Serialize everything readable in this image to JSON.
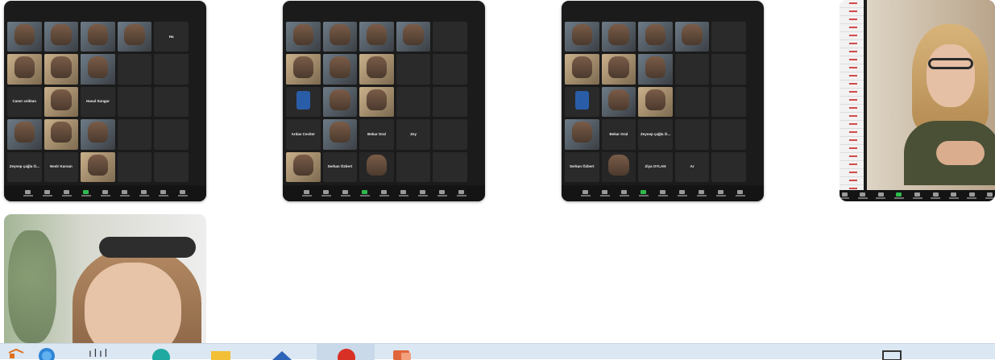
{
  "screen": "Zoom gallery view thumbnails on desktop",
  "thumbnails": [
    {
      "columns": 5,
      "tiles": [
        {
          "kind": "video",
          "bg": "room"
        },
        {
          "kind": "video",
          "bg": "room"
        },
        {
          "kind": "video",
          "bg": "room",
          "name": ""
        },
        {
          "kind": "video",
          "bg": "room",
          "name": ""
        },
        {
          "kind": "text",
          "text": "Ha"
        },
        {
          "kind": "video",
          "bg": "warm"
        },
        {
          "kind": "video",
          "bg": "warm"
        },
        {
          "kind": "video",
          "bg": "room",
          "active": true
        },
        {
          "kind": "text",
          "text": ""
        },
        {
          "kind": "text",
          "text": ""
        },
        {
          "kind": "text",
          "text": "Caner ceiktan"
        },
        {
          "kind": "video",
          "bg": "warm"
        },
        {
          "kind": "text",
          "text": "Hasal Sungar"
        },
        {
          "kind": "text",
          "text": ""
        },
        {
          "kind": "text",
          "text": ""
        },
        {
          "kind": "video",
          "bg": "room"
        },
        {
          "kind": "video",
          "bg": "warm"
        },
        {
          "kind": "video",
          "bg": "room"
        },
        {
          "kind": "text",
          "text": ""
        },
        {
          "kind": "text",
          "text": ""
        },
        {
          "kind": "text",
          "text": "Zeynep çağla Ö..."
        },
        {
          "kind": "text",
          "text": "Neslr Karsan"
        },
        {
          "kind": "video",
          "bg": "warm"
        },
        {
          "kind": "text",
          "text": ""
        },
        {
          "kind": "text",
          "text": ""
        }
      ]
    },
    {
      "columns": 5,
      "tiles": [
        {
          "kind": "video",
          "bg": "room"
        },
        {
          "kind": "video",
          "bg": "room"
        },
        {
          "kind": "video",
          "bg": "room"
        },
        {
          "kind": "video",
          "bg": "room"
        },
        {
          "kind": "text",
          "text": ""
        },
        {
          "kind": "video",
          "bg": "warm",
          "active": true
        },
        {
          "kind": "video",
          "bg": "room"
        },
        {
          "kind": "video",
          "bg": "warm"
        },
        {
          "kind": "text",
          "text": ""
        },
        {
          "kind": "text",
          "text": ""
        },
        {
          "kind": "badge"
        },
        {
          "kind": "video",
          "bg": "room"
        },
        {
          "kind": "video",
          "bg": "warm"
        },
        {
          "kind": "text",
          "text": ""
        },
        {
          "kind": "text",
          "text": ""
        },
        {
          "kind": "text",
          "text": "Ardas Ceviter"
        },
        {
          "kind": "video",
          "bg": "room"
        },
        {
          "kind": "text",
          "text": "Bekar Oral"
        },
        {
          "kind": "text",
          "text": "Zey"
        },
        {
          "kind": "text",
          "text": ""
        },
        {
          "kind": "video",
          "bg": "warm"
        },
        {
          "kind": "text",
          "text": "Serkan Özbert"
        },
        {
          "kind": "video",
          "bg": "dark"
        },
        {
          "kind": "text",
          "text": ""
        },
        {
          "kind": "text",
          "text": ""
        }
      ]
    },
    {
      "columns": 5,
      "tiles": [
        {
          "kind": "video",
          "bg": "room"
        },
        {
          "kind": "video",
          "bg": "room"
        },
        {
          "kind": "video",
          "bg": "room"
        },
        {
          "kind": "video",
          "bg": "room"
        },
        {
          "kind": "text",
          "text": ""
        },
        {
          "kind": "video",
          "bg": "warm"
        },
        {
          "kind": "video",
          "bg": "warm"
        },
        {
          "kind": "video",
          "bg": "room",
          "active": true
        },
        {
          "kind": "text",
          "text": ""
        },
        {
          "kind": "text",
          "text": ""
        },
        {
          "kind": "badge"
        },
        {
          "kind": "video",
          "bg": "room"
        },
        {
          "kind": "video",
          "bg": "warm"
        },
        {
          "kind": "text",
          "text": ""
        },
        {
          "kind": "text",
          "text": ""
        },
        {
          "kind": "video",
          "bg": "room"
        },
        {
          "kind": "text",
          "text": "Bekar Oral"
        },
        {
          "kind": "text",
          "text": "Zeynep çağla Ö..."
        },
        {
          "kind": "text",
          "text": ""
        },
        {
          "kind": "text",
          "text": ""
        },
        {
          "kind": "text",
          "text": "Serkan Özbert"
        },
        {
          "kind": "video",
          "bg": "dark"
        },
        {
          "kind": "text",
          "text": "Ziya OYLAN"
        },
        {
          "kind": "text",
          "text": "Ar"
        },
        {
          "kind": "text",
          "text": ""
        }
      ]
    }
  ],
  "taskbar": {
    "label": "ılıl",
    "icons": [
      "windows-start-icon",
      "weather-icon",
      "edge-browser-icon",
      "file-explorer-icon",
      "store-icon",
      "chrome-icon",
      "powerpoint-icon",
      "tablet-mode-icon"
    ]
  }
}
